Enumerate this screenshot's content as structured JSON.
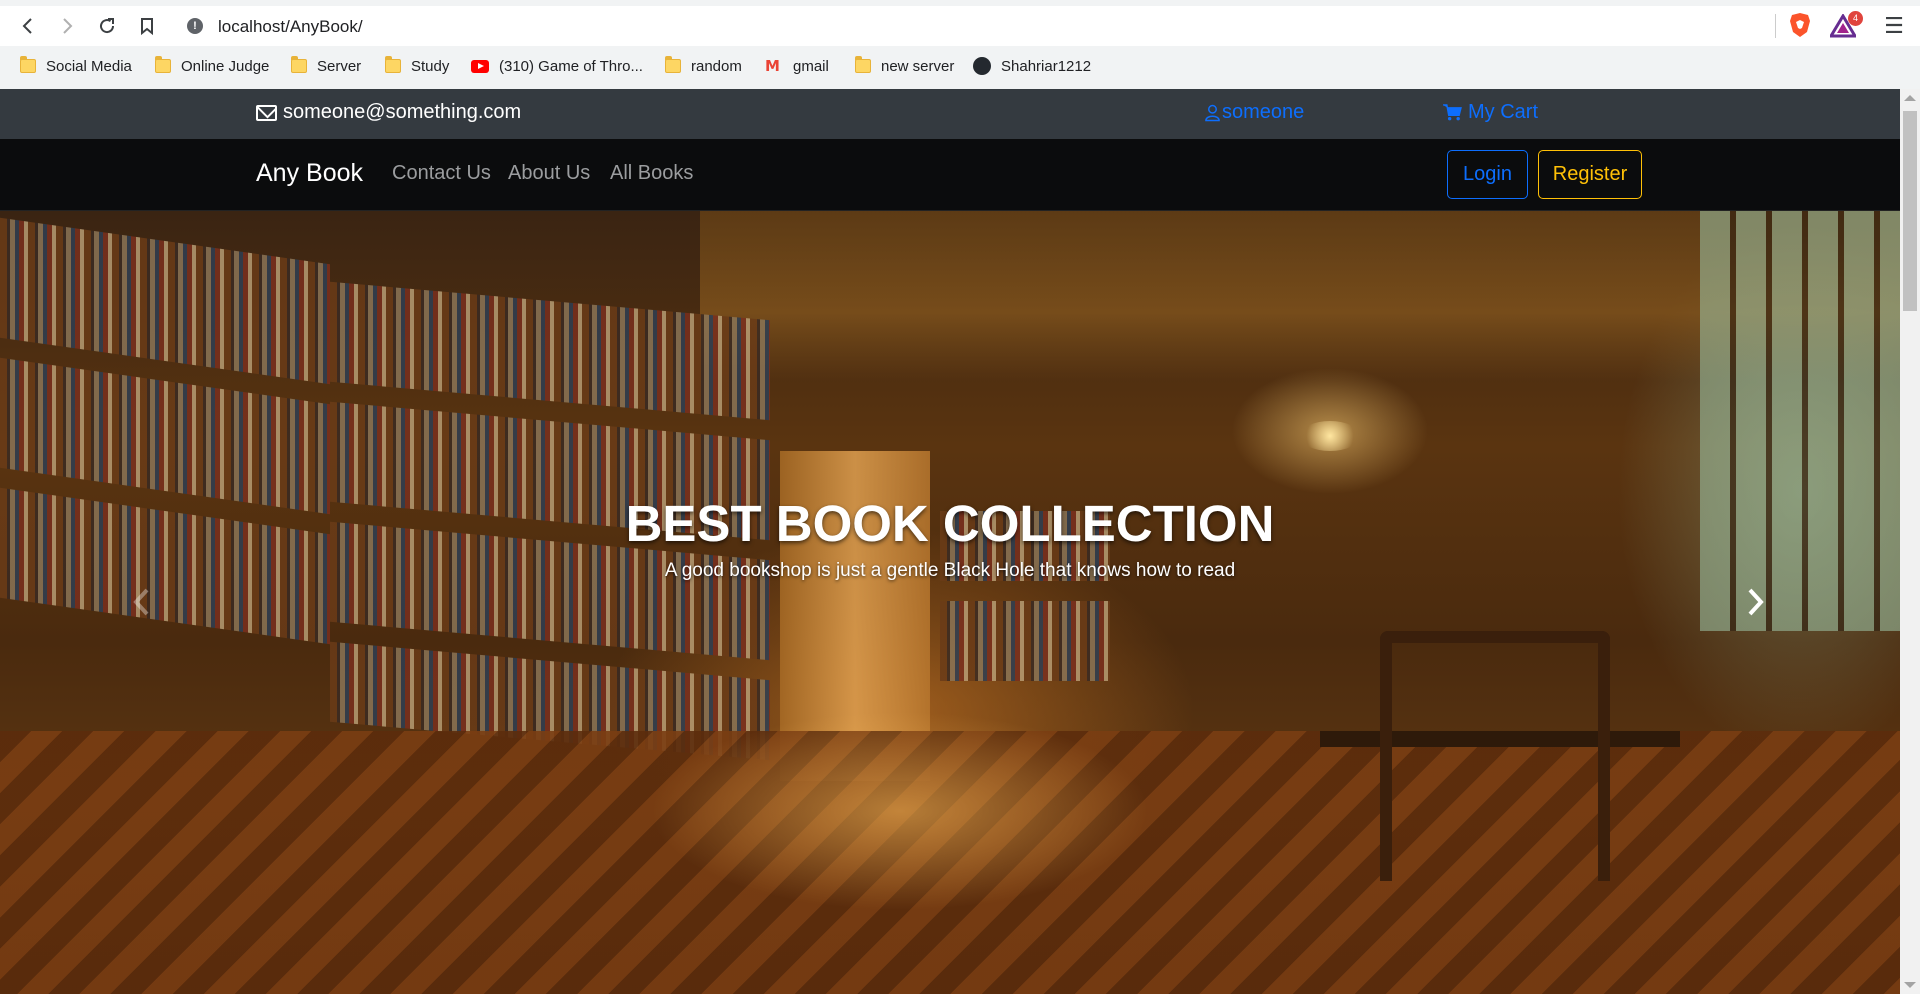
{
  "browser": {
    "url": "localhost/AnyBook/",
    "rewards_badge": "4",
    "bookmarks": [
      {
        "label": "Social Media",
        "icon": "folder-icon"
      },
      {
        "label": "Online Judge",
        "icon": "folder-icon"
      },
      {
        "label": "Server",
        "icon": "folder-icon"
      },
      {
        "label": "Study",
        "icon": "folder-icon"
      },
      {
        "label": "(310) Game of Thro...",
        "icon": "youtube-icon"
      },
      {
        "label": "random",
        "icon": "folder-icon"
      },
      {
        "label": "gmail",
        "icon": "gmail-icon"
      },
      {
        "label": "new server",
        "icon": "folder-icon"
      },
      {
        "label": "Shahriar1212",
        "icon": "github-icon"
      }
    ]
  },
  "topbar": {
    "email": "someone@something.com",
    "user": "someone",
    "cart": "My Cart"
  },
  "navbar": {
    "brand": "Any Book",
    "links": [
      "Contact Us",
      "About Us",
      "All Books"
    ],
    "login": "Login",
    "register": "Register"
  },
  "hero": {
    "title": "BEST BOOK COLLECTION",
    "subtitle": "A good bookshop is just a gentle Black Hole that knows how to read"
  },
  "colors": {
    "topbar_bg": "#343a40",
    "navbar_bg": "#0b0c0d",
    "link_blue": "#0d6efd",
    "register_yellow": "#ffc107"
  }
}
